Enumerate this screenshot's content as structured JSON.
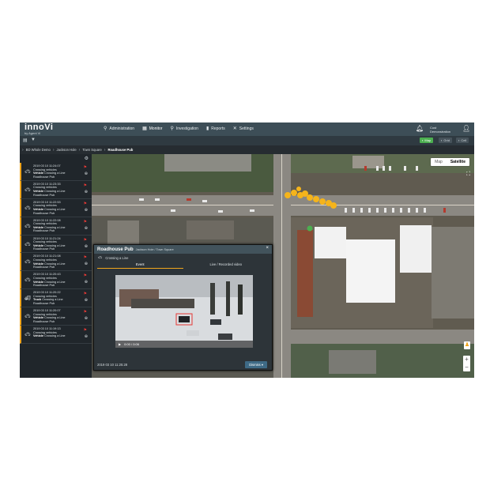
{
  "app": {
    "logo": "innoVi",
    "logo_sub": "by Agent Vi"
  },
  "nav": [
    {
      "label": "Administration",
      "icon": "sitemap-icon"
    },
    {
      "label": "Monitor",
      "icon": "calendar-icon"
    },
    {
      "label": "Investigation",
      "icon": "search-icon"
    },
    {
      "label": "Reports",
      "icon": "bar-chart-icon"
    },
    {
      "label": "Settings",
      "icon": "wrench-icon"
    }
  ],
  "user": {
    "line1": "Cust",
    "line2": "Demonstration"
  },
  "view_toggles": [
    {
      "label": "Map",
      "active": true
    },
    {
      "label": "Grid",
      "active": false
    },
    {
      "label": "Cell",
      "active": false
    }
  ],
  "breadcrumb": [
    "BD Whole Demo",
    "Jackson Hole",
    "Town Square",
    "Roadhouse Pub"
  ],
  "events": [
    {
      "time": "2019 03 10 11:24:07",
      "type": "Crossing vehicles",
      "object": "Vehicle",
      "rule": "Crossing a Line",
      "place": "Roadhouse Pub"
    },
    {
      "time": "2019 03 10 11:23:33",
      "type": "Crossing vehicles",
      "object": "Vehicle",
      "rule": "Crossing a Line",
      "place": "Roadhouse Pub"
    },
    {
      "time": "2019 03 10 11:22:53",
      "type": "Crossing vehicles",
      "object": "Vehicle",
      "rule": "Crossing a Line",
      "place": "Roadhouse Pub"
    },
    {
      "time": "2019 03 10 11:22:08",
      "type": "Crossing vehicles",
      "object": "Vehicle",
      "rule": "Crossing a Line",
      "place": "Roadhouse Pub"
    },
    {
      "time": "2019 03 10 11:21:24",
      "type": "Crossing vehicles",
      "object": "Vehicle",
      "rule": "Crossing a Line",
      "place": "Roadhouse Pub"
    },
    {
      "time": "2019 03 10 11:21:08",
      "type": "Crossing vehicles",
      "object": "Vehicle",
      "rule": "Crossing a Line",
      "place": "Roadhouse Pub"
    },
    {
      "time": "2019 03 10 11:20:43",
      "type": "Crossing vehicles",
      "object": "Vehicle",
      "rule": "Crossing a Line",
      "place": "Roadhouse Pub"
    },
    {
      "time": "2019 03 10 11:20:22",
      "type": "Crossing vehicles",
      "object": "Truck",
      "rule": "Crossing a Line",
      "place": "Roadhouse Pub"
    },
    {
      "time": "2019 03 10 11:20:07",
      "type": "Crossing vehicles",
      "object": "Vehicle",
      "rule": "Crossing a Line",
      "place": "Roadhouse Pub"
    },
    {
      "time": "2019 03 10 11:19:13",
      "type": "Crossing vehicles",
      "object": "Vehicle",
      "rule": "Crossing a Line",
      "place": ""
    }
  ],
  "map": {
    "btn_map": "Map",
    "btn_satellite": "Satellite",
    "zoom_in": "+",
    "zoom_out": "−"
  },
  "popup": {
    "title": "Roadhouse Pub",
    "subtitle": "Jackson Hole / Town Square",
    "rule": "Crossing a Line",
    "tab_event": "Event",
    "tab_live": "Live / Recorded video",
    "video_time": "0:00 / 0:06",
    "timestamp": "2019 03 10 11:25:28",
    "dismiss": "Dismiss"
  },
  "colors": {
    "accent": "#f0a51c",
    "topbar": "#3d4e57",
    "active_toggle": "#4caf50",
    "flag": "#e53935"
  }
}
